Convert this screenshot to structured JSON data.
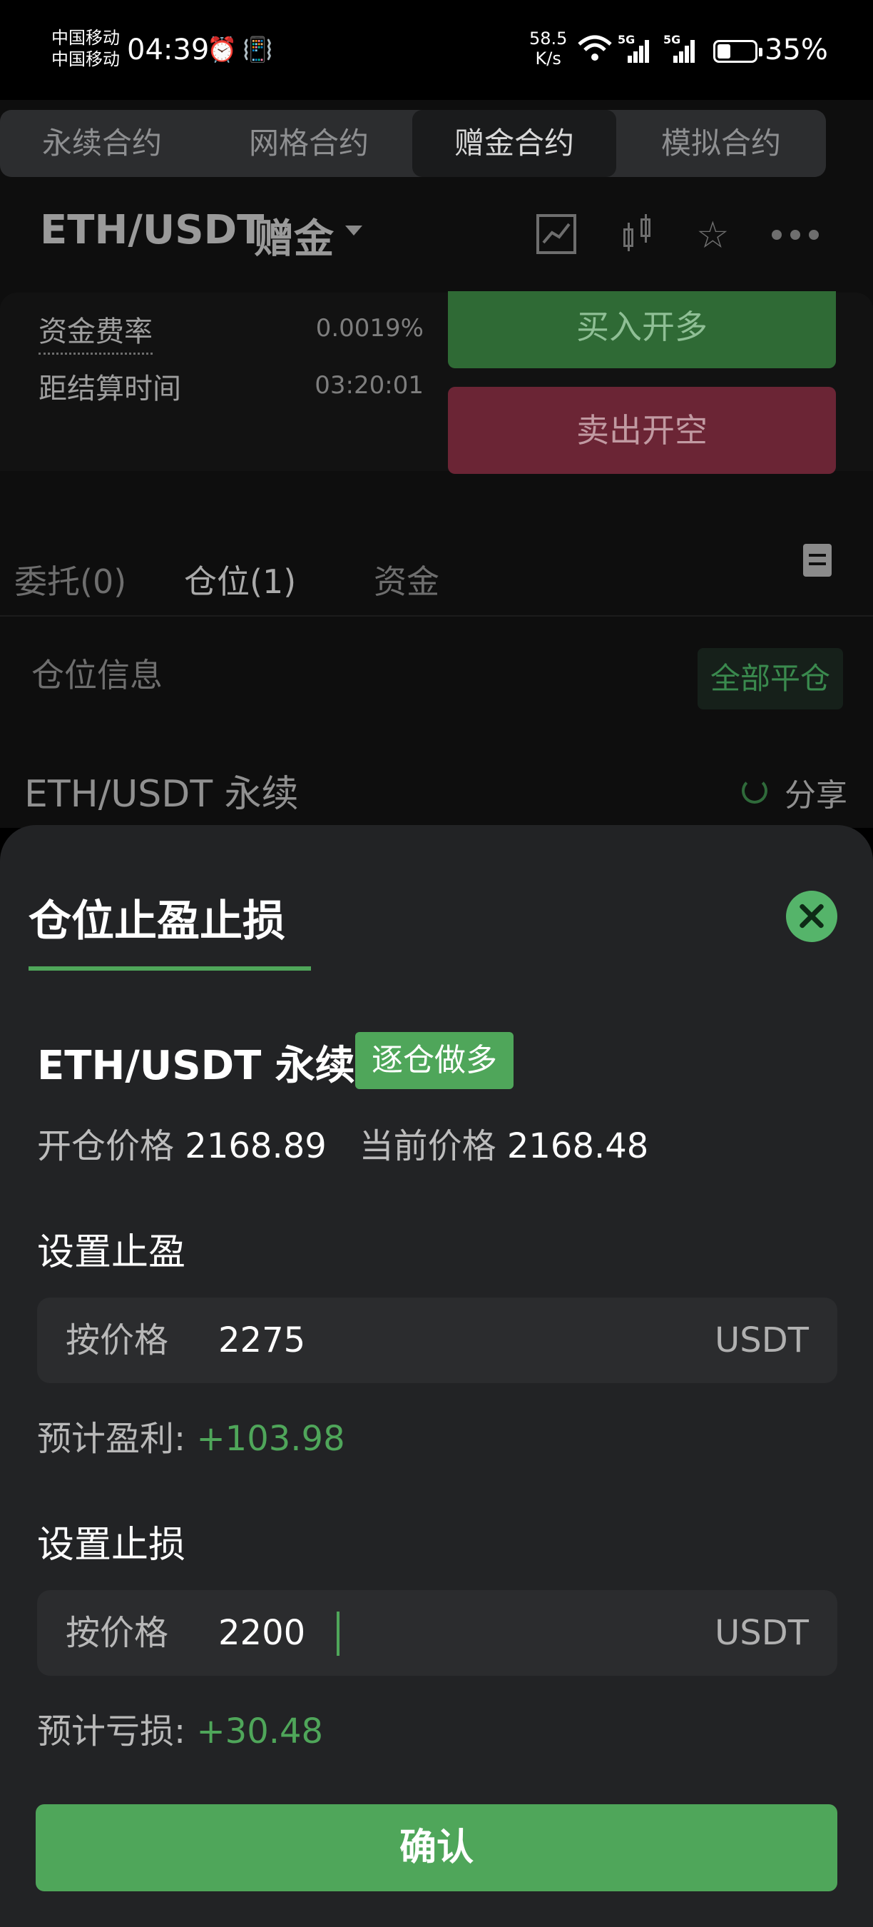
{
  "status_bar": {
    "carrier_1": "中国移动",
    "carrier_2": "中国移动",
    "time": "04:39",
    "net_speed_value": "58.5",
    "net_speed_unit": "K/s",
    "battery_percent": "35%"
  },
  "top_tabs": [
    "永续合约",
    "网格合约",
    "赠金合约",
    "模拟合约"
  ],
  "header": {
    "pair": "ETH/USDT",
    "mode": "赠金"
  },
  "info": {
    "funding_rate_label": "资金费率",
    "funding_rate_value": "0.0019%",
    "settlement_label": "距结算时间",
    "settlement_value": "03:20:01"
  },
  "actions": {
    "buy_label": "买入开多",
    "sell_label": "卖出开空"
  },
  "sub_tabs": [
    "委托(0)",
    "仓位(1)",
    "资金"
  ],
  "positions": {
    "section_label": "仓位信息",
    "close_all_label": "全部平仓",
    "pair_label": "ETH/USDT 永续",
    "share_label": "分享"
  },
  "sheet": {
    "title": "仓位止盈止损",
    "contract": "ETH/USDT 永续",
    "badge": "逐仓做多",
    "open_price_label": "开仓价格",
    "open_price": "2168.89",
    "current_price_label": "当前价格",
    "current_price": "2168.48",
    "take_profit": {
      "title": "设置止盈",
      "mode_label": "按价格",
      "value": "2275",
      "unit": "USDT",
      "estimate_label": "预计盈利:",
      "estimate_value": "+103.98"
    },
    "stop_loss": {
      "title": "设置止损",
      "mode_label": "按价格",
      "value": "2200",
      "unit": "USDT",
      "estimate_label": "预计亏损:",
      "estimate_value": "+30.48"
    },
    "confirm_label": "确认"
  },
  "colors": {
    "accent_green": "#4fa65a",
    "sell_red": "#6b2535",
    "sheet_bg": "#222325"
  }
}
